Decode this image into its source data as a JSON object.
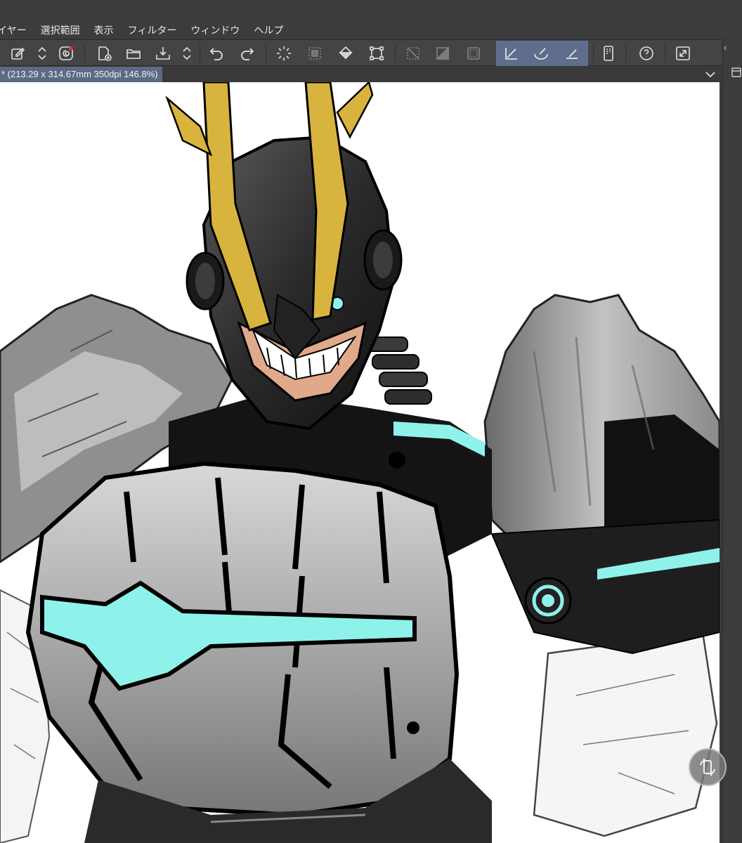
{
  "menubar": {
    "items": [
      "イヤー",
      "選択範囲",
      "表示",
      "フィルター",
      "ウィンドウ",
      "ヘルプ"
    ]
  },
  "toolbar": {
    "icons": [
      "edit-layer-icon",
      "up-down-arrows-icon",
      "spiral-app-icon",
      "new-canvas-icon",
      "open-folder-icon",
      "save-icon",
      "undo-icon",
      "redo-icon",
      "clear-icon",
      "fill-icon",
      "transform-icon",
      "deselect-icon",
      "invert-selection-icon",
      "snap-ruler-icon",
      "snap-curve-icon",
      "snap-special-ruler-icon",
      "smartphone-icon",
      "help-icon",
      "fullscreen-icon"
    ]
  },
  "document_tab": {
    "label": "* (213.29 x 314.67mm 350dpi 146.8%)"
  },
  "colors": {
    "accent_teal": "#8ef2ea",
    "gold": "#d8b43e",
    "active_tab": "#5d6a86"
  }
}
